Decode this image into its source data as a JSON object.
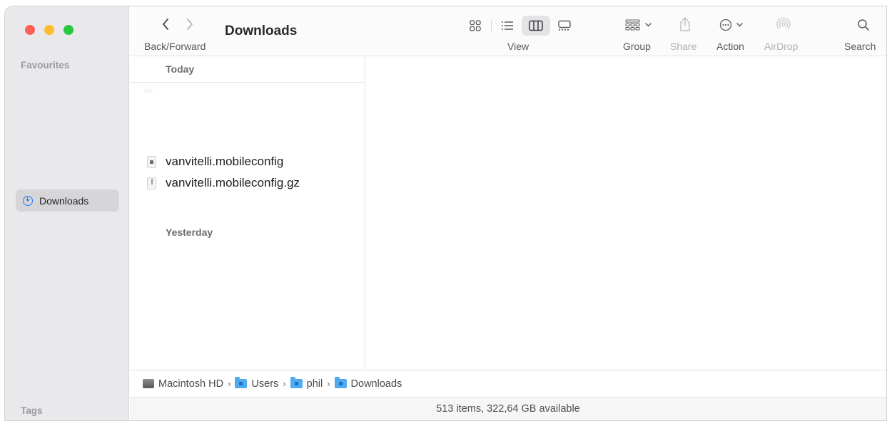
{
  "window": {
    "title": "Downloads"
  },
  "sidebar": {
    "favourites_heading": "Favourites",
    "items": [
      {
        "label": "Downloads",
        "icon": "download-circle-icon",
        "selected": true
      }
    ],
    "tags_heading": "Tags"
  },
  "toolbar": {
    "back_forward_label": "Back/Forward",
    "view_label": "View",
    "view_modes": [
      "icon-view",
      "list-view",
      "column-view",
      "gallery-view"
    ],
    "active_view": "column-view",
    "group_label": "Group",
    "share_label": "Share",
    "action_label": "Action",
    "airdrop_label": "AirDrop",
    "search_label": "Search"
  },
  "column": {
    "today_heading": "Today",
    "yesterday_heading": "Yesterday",
    "files": [
      {
        "name": "vanvitelli.mobileconfig",
        "icon": "config-file-icon"
      },
      {
        "name": "vanvitelli.mobileconfig.gz",
        "icon": "archive-file-icon"
      }
    ]
  },
  "pathbar": {
    "crumbs": [
      {
        "label": "Macintosh HD",
        "icon": "hard-drive-icon"
      },
      {
        "label": "Users",
        "icon": "folder-icon"
      },
      {
        "label": "phil",
        "icon": "folder-icon"
      },
      {
        "label": "Downloads",
        "icon": "folder-icon"
      }
    ],
    "separator": "›"
  },
  "status": {
    "text": "513 items, 322,64 GB available"
  },
  "colors": {
    "accent": "#1f7bf2",
    "close": "#fe5f57",
    "minimize": "#febc2e",
    "zoom": "#28c840",
    "folder": "#4eaaf1"
  }
}
